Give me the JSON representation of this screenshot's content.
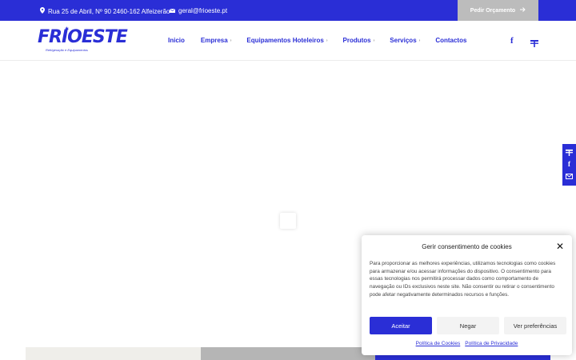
{
  "topbar": {
    "address": "Rua 25 de Abril, Nº 90 2460-162 Alfeizerão",
    "email": "geral@frioeste.pt",
    "quote_button": "Pedir Orçamento"
  },
  "logo": {
    "brand": "FRIOESTE",
    "tagline": "Refrigeração e Equipamentos"
  },
  "nav": {
    "items": [
      {
        "label": "Inicio",
        "dropdown": false
      },
      {
        "label": "Empresa",
        "dropdown": true
      },
      {
        "label": "Equipamentos Hoteleiros",
        "dropdown": true
      },
      {
        "label": "Produtos",
        "dropdown": true
      },
      {
        "label": "Serviços",
        "dropdown": true
      },
      {
        "label": "Contactos",
        "dropdown": false
      }
    ]
  },
  "icons": {
    "facebook": "facebook-icon",
    "flag": "flag-icon",
    "email": "mail-icon",
    "location": "location-pin-icon",
    "arrow": "arrow-right-icon"
  },
  "colors": {
    "brand": "#2a2ed6",
    "gray_button": "#bcbcbc"
  },
  "cookie": {
    "title": "Gerir consentimento de cookies",
    "text": "Para proporcionar as melhores experiências, utilizamos tecnologias como cookies para armazenar e/ou acessar informações do dispositivo. O consentimento para essas tecnologias nos permitirá processar dados como comportamento de navegação ou IDs exclusivos neste site. Não consentir ou retirar o consentimento pode afetar negativamente determinados recursos e funções.",
    "accept": "Aceitar",
    "deny": "Negar",
    "preferences": "Ver preferências",
    "cookie_policy": "Política de Cookies",
    "privacy_policy": "Política de Privacidade"
  }
}
